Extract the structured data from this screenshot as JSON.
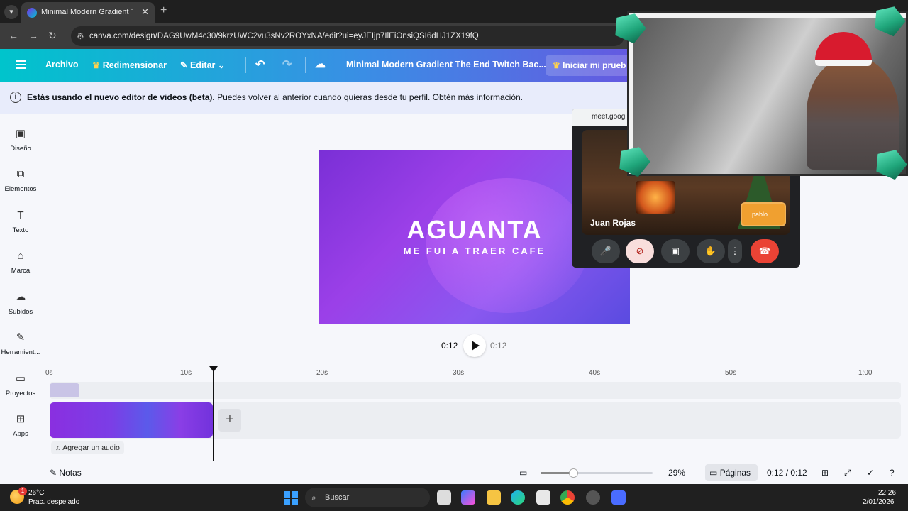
{
  "browser": {
    "tab_title": "Minimal Modern Gradient The",
    "url": "canva.com/design/DAG9UwM4c30/9krzUWC2vu3sNv2ROYxNA/edit?ui=eyJEIjp7IlEiOnsiQSI6dHJ1ZX19fQ"
  },
  "header": {
    "file_label": "Archivo",
    "resize_label": "Redimensionar",
    "edit_label": "Editar",
    "design_title": "Minimal Modern Gradient The End Twitch Bac...",
    "trial_label": "Iniciar mi prueb"
  },
  "banner": {
    "bold": "Estás usando el nuevo editor de videos (beta).",
    "text": " Puedes volver al anterior cuando quieras desde ",
    "link1": "tu perfil",
    "link2": "Obtén más información"
  },
  "sidebar": {
    "items": [
      {
        "label": "Diseño"
      },
      {
        "label": "Elementos"
      },
      {
        "label": "Texto"
      },
      {
        "label": "Marca"
      },
      {
        "label": "Subidos"
      },
      {
        "label": "Herramient..."
      },
      {
        "label": "Proyectos"
      },
      {
        "label": "Apps"
      }
    ]
  },
  "canvas": {
    "headline": "AGUANTA",
    "subtitle": "ME FUI A TRAER CAFE"
  },
  "playback": {
    "current": "0:12",
    "total": "0:12"
  },
  "timeline": {
    "ticks": [
      "0s",
      "10s",
      "20s",
      "30s",
      "40s",
      "50s",
      "1:00"
    ],
    "add_audio": "Agregar un audio"
  },
  "footer": {
    "notes": "Notas",
    "zoom": "29%",
    "zoom_level": 0.29,
    "pages": "Páginas",
    "time": "0:12 / 0:12"
  },
  "meet": {
    "header": "meet.goog",
    "participant": "Juan Rojas",
    "tile_name": "pablo ..."
  },
  "taskbar": {
    "temp": "26°C",
    "weather": "Prac. despejado",
    "weather_badge": "1",
    "search": "Buscar",
    "time": "22:26",
    "date": "2/01/2026"
  }
}
